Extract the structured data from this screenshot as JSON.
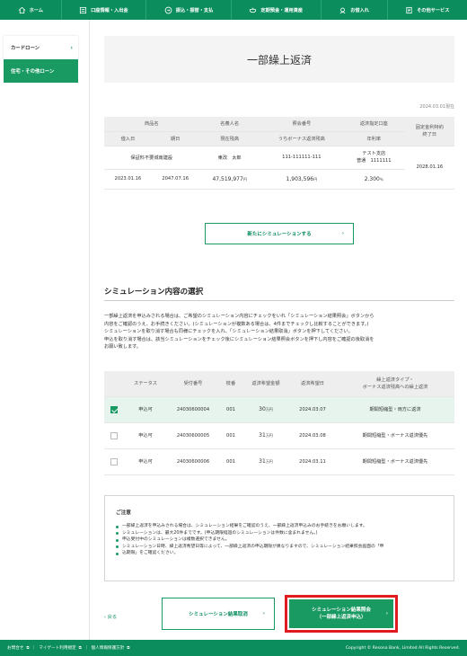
{
  "nav": [
    {
      "label": "ホーム",
      "icon": "home-icon"
    },
    {
      "label": "口座情報・入出金",
      "icon": "account-icon"
    },
    {
      "label": "振込・振替・支払",
      "icon": "transfer-icon"
    },
    {
      "label": "定期預金・運用資産",
      "icon": "savings-icon"
    },
    {
      "label": "お借入れ",
      "icon": "loan-icon"
    },
    {
      "label": "その他サービス",
      "icon": "services-icon"
    }
  ],
  "sidebar": {
    "card_loan": "カードローン",
    "housing_loan": "住宅・その他ローン"
  },
  "page": {
    "title": "一部繰上返済",
    "date_note": "2024.03.01現在"
  },
  "loan_table": {
    "header1": [
      "商品名",
      "名義人名",
      "照会番号",
      "返済指定口座",
      "固定金利特約\n終了日"
    ],
    "header2": [
      "借入日",
      "期日",
      "現在残高",
      "うちボーナス返済残高",
      "年利率"
    ],
    "row1": {
      "product": "保証料不要城南建設",
      "holder": "東改　太郎",
      "ref_no": "111-111111-111",
      "account_line1": "テスト支店",
      "account_line2": "普通　1111111",
      "fixed_end": "2028.01.16"
    },
    "row2": {
      "borrow_date": "2023.01.16",
      "due_date": "2047.07.16",
      "balance": "47,519,977",
      "bonus_balance": "1,903,596",
      "rate": "2.300",
      "yen": "円",
      "pct": "％"
    }
  },
  "new_sim_button": "新たにシミュレーションする",
  "section": {
    "title": "シミュレーション内容の選択",
    "desc": [
      "一部繰上返済を申込みされる場合は、ご希望のシミュレーション内容にチェックをいれ「シミュレーション結果照会」ボタンから",
      "内容をご確認のうえ、お手続きください。(シミュレーションが複数ある場合は、4件までチェックし比較することができます。)",
      "シミュレーションを取り消す場合も同様にチェックを入れ、「シミュレーション結果取消」ボタンを押下してください。",
      "申込を取り消す場合は、該当シミュレーションをチェック後にシミュレーション結果照会ボタンを押下し内容をご確認の後取消を",
      "お願い致します。"
    ]
  },
  "sim_table": {
    "headers": [
      "",
      "ステータス",
      "受付番号",
      "枝番",
      "返済希望金額",
      "返済希望日",
      "繰上返済タイプ・\nボーナス返済残高への繰上返済"
    ],
    "unit": "万円",
    "rows": [
      {
        "checked": true,
        "status": "申込可",
        "receipt": "24030600004",
        "branch": "001",
        "amount": "30",
        "date": "2024.03.07",
        "type": "期間短縮型・両方に返済"
      },
      {
        "checked": false,
        "status": "申込可",
        "receipt": "24030600005",
        "branch": "001",
        "amount": "31",
        "date": "2024.03.08",
        "type": "期間短縮型・ボーナス返済優先"
      },
      {
        "checked": false,
        "status": "申込可",
        "receipt": "24030600006",
        "branch": "001",
        "amount": "31",
        "date": "2024.03.11",
        "type": "期間短縮型・ボーナス返済優先"
      }
    ]
  },
  "notice": {
    "title": "ご注意",
    "items": [
      "一部繰上返済を申込みされる場合は、シミュレーション結果をご確認のうえ、一部繰上返済申込みのお手続きをお願いします。",
      "シミュレーションは、最大20件までです。(申込期限経過のシミュレーションは件数に含まれません。)",
      "申込受付中のシミュレーションは複数選択できません。",
      "シミュレーション日時、繰上返済希望日等によって、一部繰上返済の申込期限が異なりますので、シミュレーション結果照会画面の「申",
      "込期限」をご確認ください。"
    ]
  },
  "buttons": {
    "back": "戻る",
    "cancel": "シミュレーション結果取消",
    "confirm_line1": "シミュレーション結果照会",
    "confirm_line2": "（一部繰上返済申込）"
  },
  "footer": {
    "links": [
      "お問合せ",
      "マイゲート利用規定",
      "個人情報保護方針"
    ],
    "sep": "｜",
    "copyright": "Copyright © Resona Bank, Limited All Rights Reserved."
  }
}
